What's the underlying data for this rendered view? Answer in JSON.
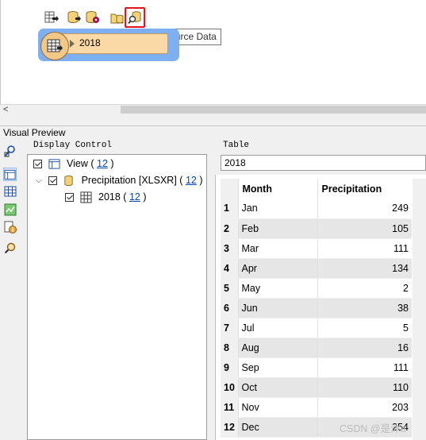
{
  "toolbar": {
    "buttons": [
      {
        "icon": "write-table-icon"
      },
      {
        "icon": "write-database-icon"
      },
      {
        "icon": "database-gear-icon"
      },
      {
        "icon": "folder-database-icon"
      },
      {
        "icon": "view-source-data-icon",
        "active": true
      }
    ],
    "tooltip": "View Source Data"
  },
  "canvas": {
    "node_label": "2018",
    "scroll_left_arrow": "<"
  },
  "visual_preview": {
    "title": "Visual Preview",
    "display_control_label": "Display Control",
    "tree": [
      {
        "label": "View",
        "count": "12",
        "open_paren": "(",
        "close_paren": ")"
      },
      {
        "label": "Precipitation [XLSXR]",
        "count": "12",
        "open_paren": "(",
        "close_paren": ")"
      },
      {
        "label": "2018",
        "count": "12",
        "open_paren": "(",
        "close_paren": ")"
      }
    ],
    "table_label": "Table",
    "table_select_value": "2018"
  },
  "table": {
    "columns": [
      "Month",
      "Precipitation"
    ],
    "rows": [
      {
        "n": "1",
        "month": "Jan",
        "precip": "249"
      },
      {
        "n": "2",
        "month": "Feb",
        "precip": "105"
      },
      {
        "n": "3",
        "month": "Mar",
        "precip": "111"
      },
      {
        "n": "4",
        "month": "Apr",
        "precip": "134"
      },
      {
        "n": "5",
        "month": "May",
        "precip": "2"
      },
      {
        "n": "6",
        "month": "Jun",
        "precip": "38"
      },
      {
        "n": "7",
        "month": "Jul",
        "precip": "5"
      },
      {
        "n": "8",
        "month": "Aug",
        "precip": "16"
      },
      {
        "n": "9",
        "month": "Sep",
        "precip": "111"
      },
      {
        "n": "10",
        "month": "Oct",
        "precip": "110"
      },
      {
        "n": "11",
        "month": "Nov",
        "precip": "203"
      },
      {
        "n": "12",
        "month": "Dec",
        "precip": "254"
      }
    ]
  },
  "watermark": "CSDN @是沐a",
  "colors": {
    "highlight_border": "#e8141b",
    "node_selection": "#7eaff0",
    "node_fill": "#fbd9a6",
    "link": "#0645ad"
  }
}
